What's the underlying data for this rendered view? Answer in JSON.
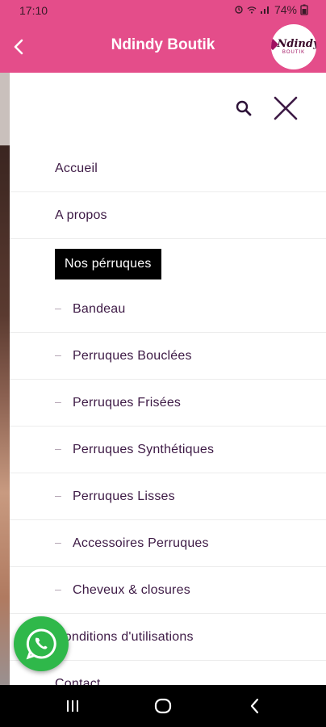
{
  "status": {
    "time": "17:10",
    "battery": "74%",
    "icons": [
      "alarm-icon",
      "wifi-icon",
      "signal-icon",
      "battery-icon"
    ]
  },
  "header": {
    "title": "Ndindy Boutik",
    "back_icon": "back-chevron-icon",
    "logo_text": "Ndindy",
    "logo_sub": "BOUTIK"
  },
  "drawer": {
    "search_icon": "search-icon",
    "close_icon": "close-icon",
    "menu": [
      {
        "label": "Accueil",
        "type": "top"
      },
      {
        "label": "A propos",
        "type": "top"
      },
      {
        "label": "Nos pérruques",
        "type": "active"
      },
      {
        "label": "Bandeau",
        "type": "sub"
      },
      {
        "label": "Perruques Bouclées",
        "type": "sub"
      },
      {
        "label": "Perruques Frisées",
        "type": "sub"
      },
      {
        "label": "Perruques Synthétiques",
        "type": "sub"
      },
      {
        "label": "Perruques Lisses",
        "type": "sub"
      },
      {
        "label": "Accessoires Perruques",
        "type": "sub"
      },
      {
        "label": "Cheveux & closures",
        "type": "sub"
      },
      {
        "label": "Conditions d'utilisations",
        "type": "top"
      },
      {
        "label": "Contact",
        "type": "top"
      }
    ]
  },
  "colors": {
    "accent": "#e44d8a",
    "menu_text": "#3d1a45",
    "whatsapp": "#2fb84a"
  },
  "floating": {
    "icon": "whatsapp-icon"
  },
  "navbar": {
    "icons": [
      "recents-icon",
      "home-icon",
      "back-icon"
    ]
  }
}
